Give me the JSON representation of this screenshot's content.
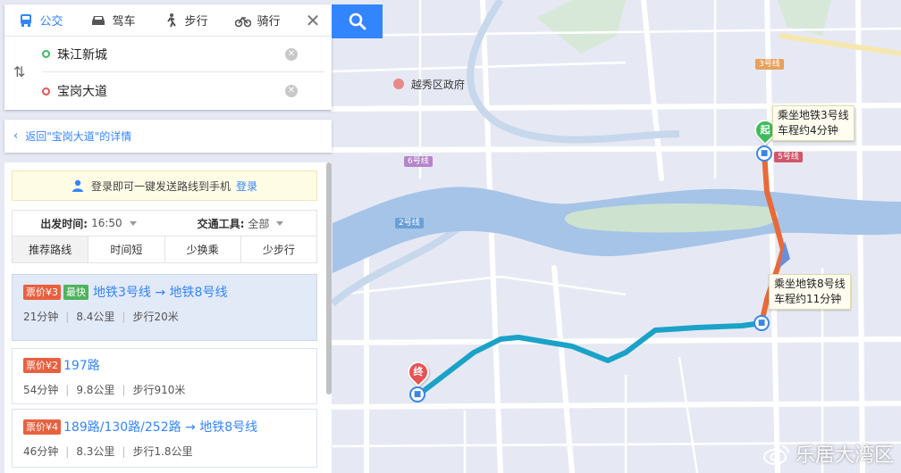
{
  "modes": [
    {
      "label": "公交",
      "icon": "bus-icon",
      "active": true
    },
    {
      "label": "驾车",
      "icon": "car-icon",
      "active": false
    },
    {
      "label": "步行",
      "icon": "walk-icon",
      "active": false
    },
    {
      "label": "骑行",
      "icon": "bike-icon",
      "active": false
    }
  ],
  "route": {
    "start": "珠江新城",
    "end": "宝岗大道"
  },
  "back_link": "返回\"宝岗大道\"的详情",
  "login_tip": {
    "text": "登录即可一键发送路线到手机",
    "link": "登录"
  },
  "filters": {
    "depart_label": "出发时间:",
    "depart_value": "16:50",
    "tool_label": "交通工具:",
    "tool_value": "全部"
  },
  "sort_tabs": [
    "推荐路线",
    "时间短",
    "少换乘",
    "少步行"
  ],
  "plans": [
    {
      "price": "票价¥3",
      "badge": "最快",
      "route": "地铁3号线 → 地铁8号线",
      "duration": "21分钟",
      "distance": "8.4公里",
      "walk": "步行20米"
    },
    {
      "price": "票价¥2",
      "badge": "",
      "route": "197路",
      "duration": "54分钟",
      "distance": "9.8公里",
      "walk": "步行910米"
    },
    {
      "price": "票价¥4",
      "badge": "",
      "route": "189路/130路/252路 → 地铁8号线",
      "duration": "46分钟",
      "distance": "8.3公里",
      "walk": "步行1.8公里"
    }
  ],
  "map": {
    "poi_govt": "越秀区政府",
    "line_tags": [
      "3号线",
      "6号线",
      "5号线",
      "2号线"
    ],
    "callout_start": {
      "line1": "乘坐地铁3号线",
      "line2": "车程约4分钟"
    },
    "callout_transfer": {
      "line1": "乘坐地铁8号线",
      "line2": "车程约11分钟"
    },
    "start_pin": "起",
    "end_pin": "终",
    "watermark": "乐居大湾区"
  },
  "colors": {
    "accent": "#3385ff",
    "price_badge": "#e8613f",
    "fast_badge": "#4fb35c",
    "river": "#a6c4e8",
    "route_metro3": "#e86a3a",
    "route_metro8": "#1aa2c8"
  }
}
